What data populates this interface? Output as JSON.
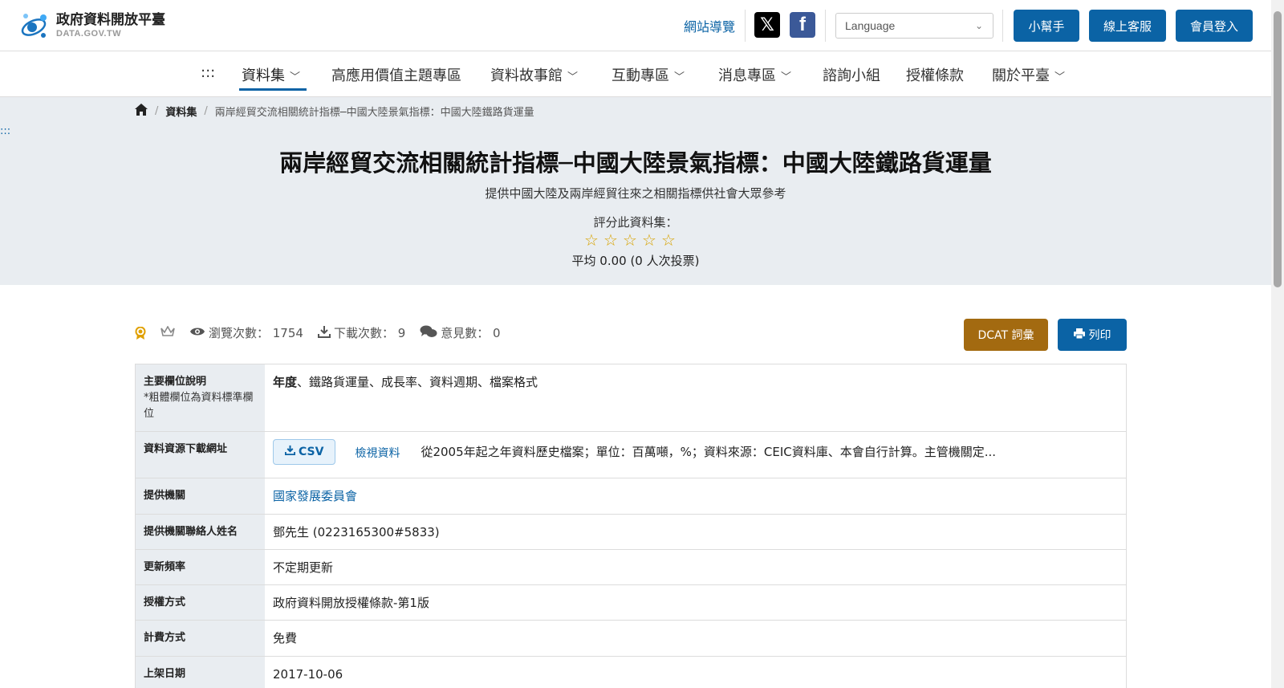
{
  "header": {
    "logo_title": "政府資料開放平臺",
    "logo_sub": "DATA.GOV.TW",
    "site_nav": "網站導覽",
    "language_placeholder": "Language",
    "helper_label": "小幫手",
    "support_label": "線上客服",
    "login_label": "會員登入"
  },
  "nav": {
    "menu_glyph": ":::",
    "items": [
      "資料集",
      "高應用價值主題專區",
      "資料故事館",
      "互動專區",
      "消息專區",
      "諮詢小組",
      "授權條款",
      "關於平臺"
    ]
  },
  "breadcrumb": {
    "level1": "資料集",
    "current": "兩岸經貿交流相關統計指標─中國大陸景氣指標：中國大陸鐵路貨運量"
  },
  "skip_link": ":::",
  "hero": {
    "title": "兩岸經貿交流相關統計指標─中國大陸景氣指標：中國大陸鐵路貨運量",
    "subtitle": "提供中國大陸及兩岸經貿往來之相關指標供社會大眾參考",
    "rate_label": "評分此資料集：",
    "rating": 0,
    "average": "平均 0.00 (0 人次投票)"
  },
  "stats": {
    "views": "瀏覽次數： 1754",
    "downloads": "下載次數： 9",
    "comments": "意見數： 0"
  },
  "actions": {
    "dcat": "DCAT 詞彙",
    "print": "列印"
  },
  "table": {
    "main_fields_key": "主要欄位說明",
    "main_fields_note": "*粗體欄位為資料標準欄位",
    "main_fields_bold": "年度",
    "main_fields_rest": "、鐵路貨運量、成長率、資料週期、檔案格式",
    "resource_key": "資料資源下載網址",
    "csv_label": "CSV",
    "view_label": "檢視資料",
    "resource_desc": "從2005年起之年資料歷史檔案；單位：百萬噸，%；資料來源：CEIC資料庫、本會自行計算。主管機關定...",
    "provider_key": "提供機關",
    "provider": "國家發展委員會",
    "contact_key": "提供機關聯絡人姓名",
    "contact": "鄧先生 (0223165300#5833)",
    "frequency_key": "更新頻率",
    "frequency": "不定期更新",
    "license_key": "授權方式",
    "license": "政府資料開放授權條款-第1版",
    "fee_key": "計費方式",
    "fee": "免費",
    "date_key": "上架日期",
    "date": "2017-10-06"
  },
  "colors": {
    "primary": "#0b63a5",
    "dcat": "#a36a10",
    "hero_bg": "#e9edf1",
    "star": "#d8a300"
  }
}
